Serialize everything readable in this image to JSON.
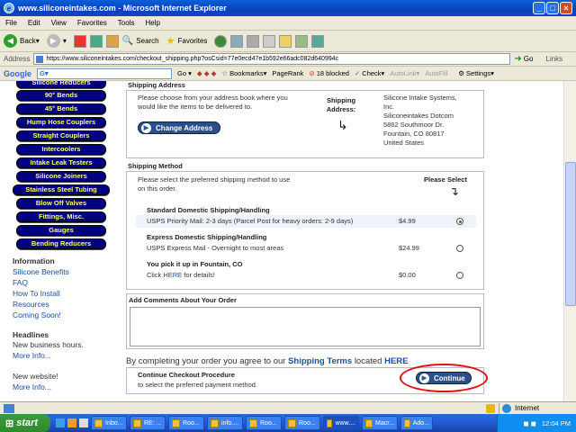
{
  "window": {
    "title": "www.siliconeintakes.com - Microsoft Internet Explorer"
  },
  "menu": [
    "File",
    "Edit",
    "View",
    "Favorites",
    "Tools",
    "Help"
  ],
  "toolbar": {
    "back": "Back",
    "search": "Search",
    "favorites": "Favorites"
  },
  "address": {
    "label": "Address",
    "url": "https://www.siliconeintakes.com/checkout_shipping.php?osCsid=77e0ecd47e1b592e66adc082d640994c",
    "go": "Go",
    "links": "Links"
  },
  "googlebar": {
    "logo": "Google",
    "g_letter": "G",
    "go": "Go",
    "bookmarks": "Bookmarks",
    "pagerank": "PageRank",
    "blocked": "18 blocked",
    "check": "Check",
    "autolink": "AutoLink",
    "autofill": "AutoFill",
    "settings": "Settings"
  },
  "sidebar": {
    "buttons": [
      "Silicone Reducers",
      "90° Bends",
      "45° Bends",
      "Hump Hose Couplers",
      "Straight Couplers",
      "Intercoolers",
      "Intake Leak Testers",
      "Silicone Joiners",
      "Stainless Steel Tubing",
      "Blow Off Valves",
      "Fittings, Misc.",
      "Gauges",
      "Bending Reducers"
    ],
    "info_heading": "Information",
    "info_links": [
      "Silicone Benefits",
      "FAQ",
      "How To Install",
      "Resources",
      "Coming Soon!"
    ],
    "headlines_heading": "Headlines",
    "news1": "New business hours.",
    "news1_more": "More Info...",
    "news2": "New website!",
    "news2_more": "More Info..."
  },
  "shipping_address": {
    "title": "Shipping Address",
    "instructions": [
      "Please choose from your address book where you",
      "would like the items to be delivered to."
    ],
    "change_button": "Change Address",
    "label": "Shipping Address:",
    "lines": [
      "Silicone Intake Systems,",
      "Inc.",
      "Siliconeintakes Dotcom",
      "5862 Southmoor Dr.",
      "Fountain, CO 80817",
      "United States"
    ]
  },
  "shipping_method": {
    "title": "Shipping Method",
    "instructions": [
      "Please select the preferred shipping method to use",
      "on this order."
    ],
    "please_select": "Please Select",
    "groups": [
      {
        "name": "Standard Domestic Shipping/Handling",
        "option": "USPS Priority Mail: 2-3 days (Parcel Post for heavy orders: 2-9 days)",
        "price": "$4.99",
        "selected": true
      },
      {
        "name": "Express Domestic Shipping/Handling",
        "option": "USPS Express Mail - Overnight to most areas",
        "price": "$24.99",
        "selected": false
      },
      {
        "name": "You pick it up in Fountain, CO",
        "option_prefix": "Click",
        "option_link": "HERE",
        "option_suffix": "for details!",
        "price": "$0.00",
        "selected": false
      }
    ]
  },
  "comments": {
    "title": "Add Comments About Your Order",
    "value": ""
  },
  "terms": {
    "prefix": "By completing your order you agree to our",
    "link": "Shipping Terms",
    "middle": "located",
    "here": "HERE"
  },
  "continue": {
    "title": "Continue Checkout Procedure",
    "subtitle": "to select the preferred payment method.",
    "button": "Continue"
  },
  "status": {
    "zone": "Internet"
  },
  "taskbar": {
    "start": "start",
    "tasks": [
      "Inbo...",
      "RE: ...",
      "Roo...",
      "info....",
      "Roo...",
      "Roo...",
      "www....",
      "Macr...",
      "Ado..."
    ],
    "clock": "12:04 PM"
  }
}
